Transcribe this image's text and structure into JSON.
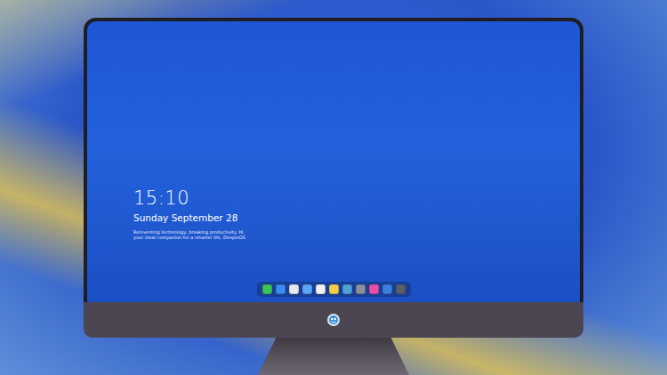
{
  "lock_screen": {
    "time": "15:10",
    "date": "Sunday September 28",
    "tagline": [
      "Reinventing technology, breaking productivity. Hi,",
      "your ideal companion for a smarter life, DeepinOS"
    ]
  },
  "dock": {
    "items": [
      {
        "color": "#3cc45a"
      },
      {
        "color": "#3b8cf0"
      },
      {
        "color": "#e8e8ea"
      },
      {
        "color": "#5aa7f5"
      },
      {
        "color": "#f2f2f2"
      },
      {
        "color": "#f7c948"
      },
      {
        "color": "#4f9fd8"
      },
      {
        "color": "#8a8f99"
      },
      {
        "color": "#e94fa8"
      },
      {
        "color": "#3d7fe0"
      },
      {
        "color": "#5b5f68"
      }
    ]
  }
}
